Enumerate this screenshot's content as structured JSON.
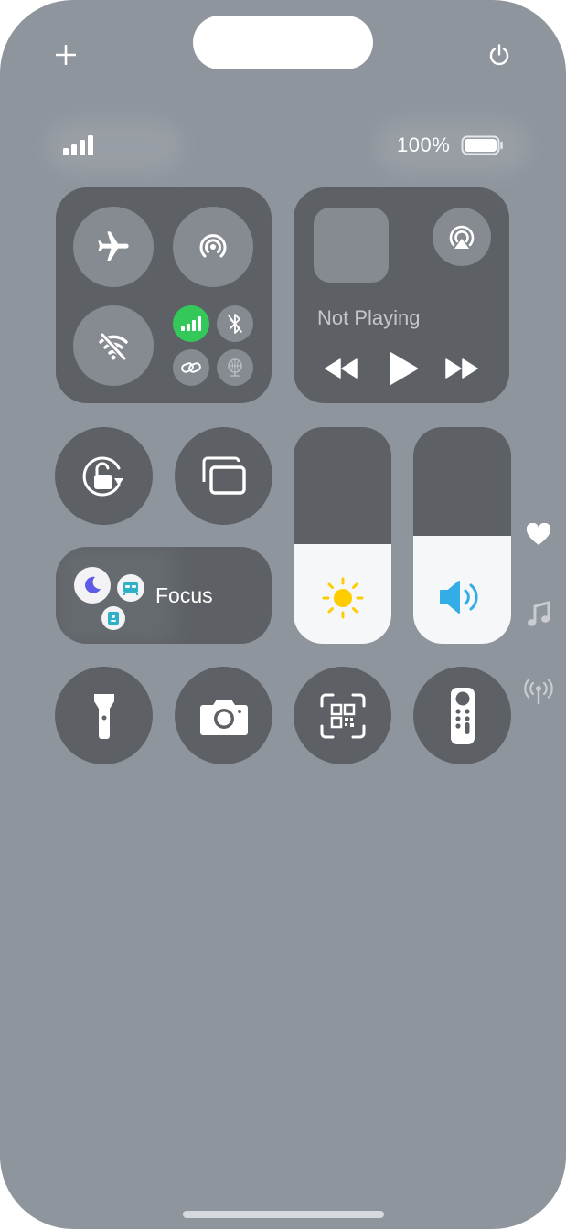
{
  "status_bar": {
    "battery_percent": "100%",
    "battery_level": 1.0,
    "signal_bars": 4
  },
  "top_controls": {
    "add_icon": "plus-icon",
    "power_icon": "power-icon"
  },
  "connectivity": {
    "airplane_mode": "off",
    "airdrop": "off",
    "wifi": "off",
    "cellular": "on",
    "bluetooth": "off",
    "personal_hotspot": "off",
    "satellite": "off"
  },
  "media": {
    "status": "Not Playing"
  },
  "focus": {
    "label": "Focus"
  },
  "sliders": {
    "brightness_level": 0.46,
    "volume_level": 0.5
  },
  "colors": {
    "background": "#8f959d",
    "tile": "#5d6166",
    "cellular_green": "#34c759",
    "sun_yellow": "#ffcc00",
    "speaker_blue": "#32ade6",
    "moon_purple": "#5e5ce6",
    "bed_teal": "#30b0c7"
  },
  "side_page_icons": [
    "heart-icon",
    "music-note-icon",
    "broadcast-icon"
  ]
}
